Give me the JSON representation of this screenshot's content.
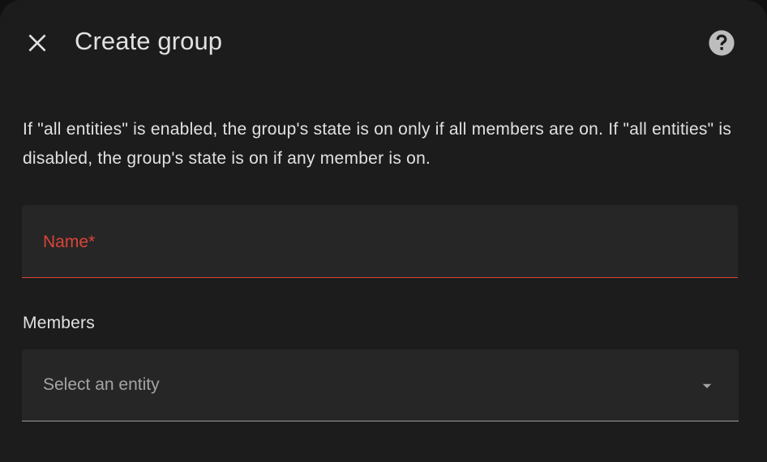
{
  "dialog": {
    "title": "Create group",
    "description": "If \"all entities\" is enabled, the group's state is on only if all members are on. If \"all entities\" is disabled, the group's state is on if any member is on."
  },
  "icons": {
    "close": "close-icon",
    "help": "help-circle-icon",
    "dropdown": "menu-down-icon"
  },
  "form": {
    "name_label": "Name*",
    "name_value": "",
    "members_label": "Members",
    "entity_placeholder": "Select an entity"
  },
  "colors": {
    "background": "#1c1c1c",
    "field_background": "#262626",
    "error": "#db4437",
    "text_primary": "#e1e1e1",
    "text_secondary": "#a4a4a4"
  }
}
